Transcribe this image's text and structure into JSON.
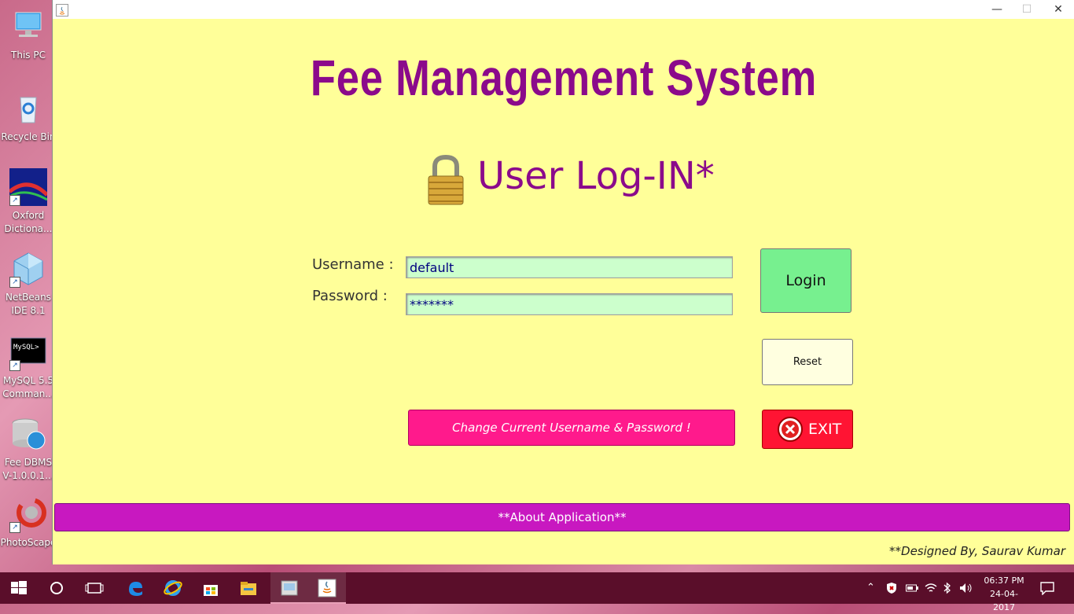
{
  "desktop": {
    "icons": [
      {
        "label": "This PC"
      },
      {
        "label": "Recycle Bin"
      },
      {
        "label": "Oxford\nDictiona..."
      },
      {
        "label": "NetBeans\nIDE 8.1"
      },
      {
        "label": "MySQL 5.5\nComman..."
      },
      {
        "label": "Fee DBMS\nV-1.0.0.1..."
      },
      {
        "label": "PhotoScape"
      }
    ]
  },
  "window": {
    "controls": {
      "minimize": "—",
      "maximize": "☐",
      "close": "✕"
    }
  },
  "app": {
    "title": "Fee Management System",
    "login_heading": "User Log-IN*",
    "username_label": "Username :",
    "password_label": "Password  :",
    "username_value": "default",
    "password_value": "*******",
    "login_button": "Login",
    "reset_button": "Reset",
    "change_button": "Change Current Username & Password !",
    "exit_button": "EXIT",
    "about_button": "**About Application**",
    "designer": "**Designed By, Saurav Kumar"
  },
  "taskbar": {
    "time": "06:37 PM",
    "date": "24-04-2017"
  },
  "colors": {
    "window_bg": "#ffff99",
    "title_purple": "#8b0a8b",
    "login_green": "#77f08f",
    "change_pink": "#ff1a8c",
    "exit_red": "#ff1433",
    "about_magenta": "#c818c0",
    "taskbar": "#5a0e2a"
  }
}
